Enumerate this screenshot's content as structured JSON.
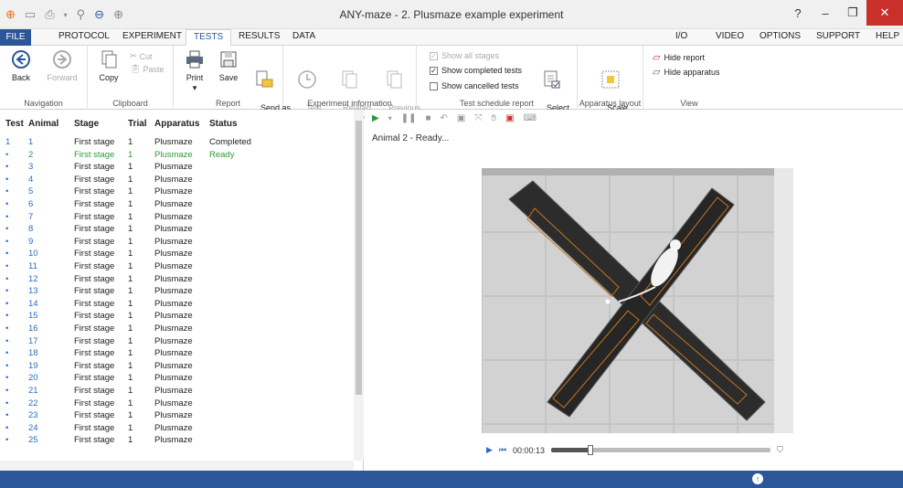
{
  "window": {
    "title": "ANY-maze - 2. Plusmaze example experiment"
  },
  "menu": [
    "FILE",
    "PROTOCOL",
    "EXPERIMENT",
    "TESTS",
    "RESULTS",
    "DATA",
    "I/O",
    "VIDEO",
    "OPTIONS",
    "SUPPORT",
    "HELP"
  ],
  "ribbon": {
    "navigation": {
      "back": "Back",
      "forward": "Forward",
      "label": "Navigation"
    },
    "clipboard": {
      "copy": "Copy",
      "cut": "Cut",
      "paste": "Paste",
      "label": "Clipboard"
    },
    "report": {
      "print": "Print",
      "save": "Save",
      "send": "Send as\ne-mail",
      "label": "Report"
    },
    "experiment_information": {
      "test_schedule": "Test\nschedule",
      "related_reports": "Related\nreports ▾",
      "previous_report": "Previous\nreport",
      "label": "Experiment information"
    },
    "test_schedule_report": {
      "show_all_stages": "Show all stages",
      "show_completed": "Show completed tests",
      "show_cancelled": "Show cancelled tests",
      "select_columns": "Select\ncolumns",
      "label": "Test schedule report"
    },
    "apparatus_layout": {
      "scale_to_fit": "Scale\nto fit",
      "label": "Apparatus layout"
    },
    "view": {
      "hide_report": "Hide report",
      "hide_apparatus": "Hide apparatus",
      "label": "View"
    }
  },
  "table": {
    "headers": [
      "Test",
      "Animal",
      "Stage",
      "Trial",
      "Apparatus",
      "Status"
    ],
    "rows": [
      [
        "1",
        "1",
        "First stage",
        "1",
        "Plusmaze",
        "Completed"
      ],
      [
        "•",
        "2",
        "First stage",
        "1",
        "Plusmaze",
        "Ready"
      ],
      [
        "•",
        "3",
        "First stage",
        "1",
        "Plusmaze",
        ""
      ],
      [
        "•",
        "4",
        "First stage",
        "1",
        "Plusmaze",
        ""
      ],
      [
        "•",
        "5",
        "First stage",
        "1",
        "Plusmaze",
        ""
      ],
      [
        "•",
        "6",
        "First stage",
        "1",
        "Plusmaze",
        ""
      ],
      [
        "•",
        "7",
        "First stage",
        "1",
        "Plusmaze",
        ""
      ],
      [
        "•",
        "8",
        "First stage",
        "1",
        "Plusmaze",
        ""
      ],
      [
        "•",
        "9",
        "First stage",
        "1",
        "Plusmaze",
        ""
      ],
      [
        "•",
        "10",
        "First stage",
        "1",
        "Plusmaze",
        ""
      ],
      [
        "•",
        "11",
        "First stage",
        "1",
        "Plusmaze",
        ""
      ],
      [
        "•",
        "12",
        "First stage",
        "1",
        "Plusmaze",
        ""
      ],
      [
        "•",
        "13",
        "First stage",
        "1",
        "Plusmaze",
        ""
      ],
      [
        "•",
        "14",
        "First stage",
        "1",
        "Plusmaze",
        ""
      ],
      [
        "•",
        "15",
        "First stage",
        "1",
        "Plusmaze",
        ""
      ],
      [
        "•",
        "16",
        "First stage",
        "1",
        "Plusmaze",
        ""
      ],
      [
        "•",
        "17",
        "First stage",
        "1",
        "Plusmaze",
        ""
      ],
      [
        "•",
        "18",
        "First stage",
        "1",
        "Plusmaze",
        ""
      ],
      [
        "•",
        "19",
        "First stage",
        "1",
        "Plusmaze",
        ""
      ],
      [
        "•",
        "20",
        "First stage",
        "1",
        "Plusmaze",
        ""
      ],
      [
        "•",
        "21",
        "First stage",
        "1",
        "Plusmaze",
        ""
      ],
      [
        "•",
        "22",
        "First stage",
        "1",
        "Plusmaze",
        ""
      ],
      [
        "•",
        "23",
        "First stage",
        "1",
        "Plusmaze",
        ""
      ],
      [
        "•",
        "24",
        "First stage",
        "1",
        "Plusmaze",
        ""
      ],
      [
        "•",
        "25",
        "First stage",
        "1",
        "Plusmaze",
        ""
      ]
    ]
  },
  "player": {
    "status": "Animal 2 - Ready...",
    "time": "00:00:13",
    "progress": 0.18
  },
  "colors": {
    "accent": "#2b579a",
    "ready": "#2e9a3a",
    "link": "#2b6cc4"
  }
}
